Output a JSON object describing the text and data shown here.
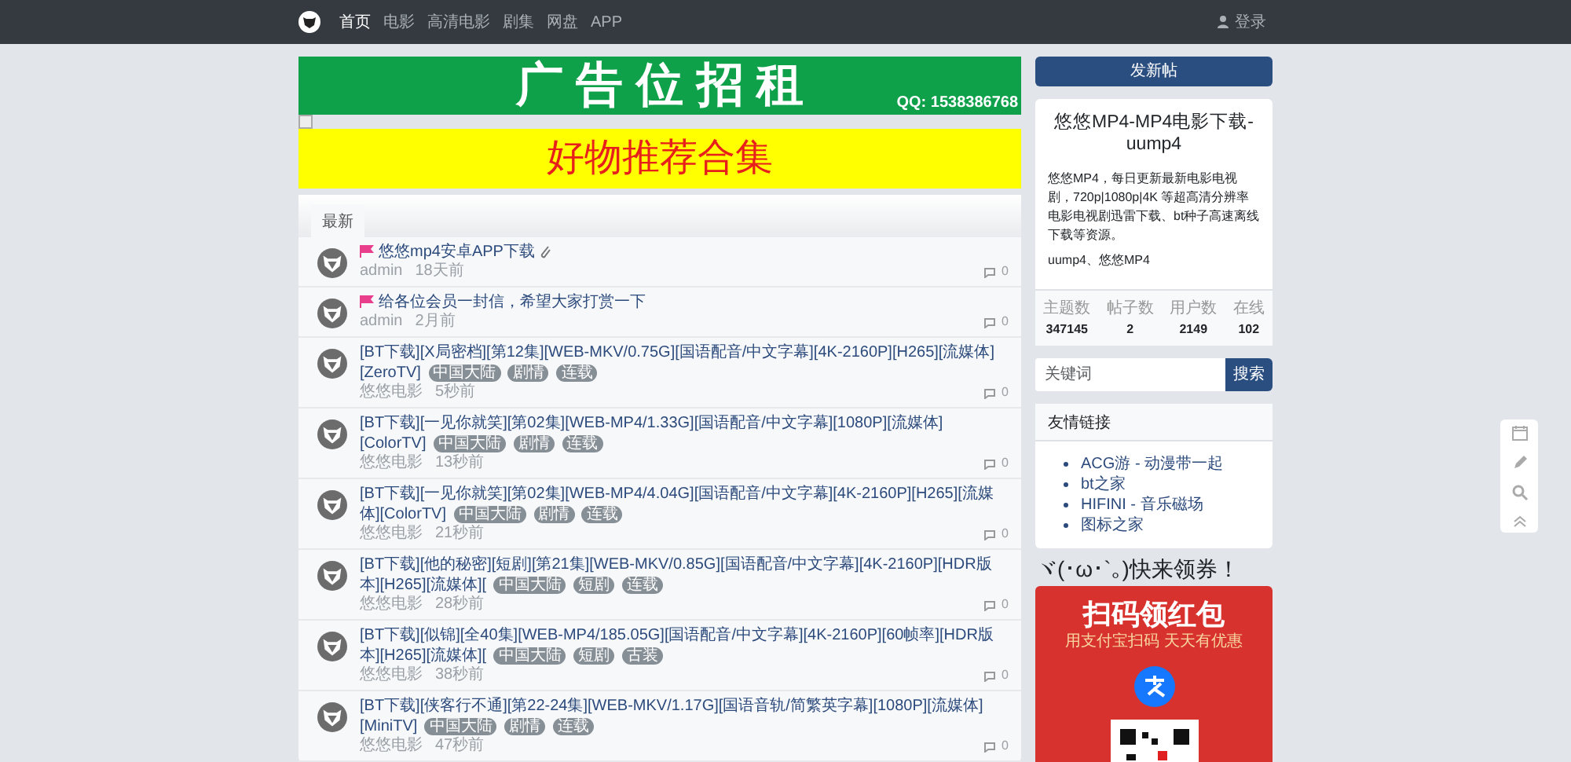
{
  "navbar": {
    "items": [
      {
        "label": "首页",
        "selected": true
      },
      {
        "label": "电影",
        "selected": false
      },
      {
        "label": "高清电影",
        "selected": false
      },
      {
        "label": "剧集",
        "selected": false
      },
      {
        "label": "网盘",
        "selected": false
      },
      {
        "label": "APP",
        "selected": false
      }
    ],
    "login": "登录"
  },
  "banners": [
    {
      "kind": "rent",
      "title": "广 告 位 招 租",
      "contact": "QQ: 1538386768"
    },
    {
      "kind": "broken"
    },
    {
      "kind": "promo",
      "title": "好物推荐合集"
    }
  ],
  "tabs": [
    {
      "label": "最新",
      "selected": true
    }
  ],
  "threads": [
    {
      "title": "悠悠mp4安卓APP下载",
      "pinned": true,
      "attachment": true,
      "author": "admin",
      "time": "18天前",
      "replies": "0"
    },
    {
      "title": "给各位会员一封信，希望大家打赏一下",
      "pinned": true,
      "attachment": false,
      "author": "admin",
      "time": "2月前",
      "replies": "0"
    },
    {
      "title": "[BT下载][X局密档][第12集][WEB-MKV/0.75G][国语配音/中文字幕][4K-2160P][H265][流媒体][ZeroTV]",
      "pinned": false,
      "attachment": false,
      "tags": [
        "中国大陆",
        "剧情",
        "连载"
      ],
      "author": "悠悠电影",
      "time": "5秒前",
      "replies": "0"
    },
    {
      "title": "[BT下载][一见你就笑][第02集][WEB-MP4/1.33G][国语配音/中文字幕][1080P][流媒体][ColorTV]",
      "pinned": false,
      "attachment": false,
      "tags": [
        "中国大陆",
        "剧情",
        "连载"
      ],
      "author": "悠悠电影",
      "time": "13秒前",
      "replies": "0"
    },
    {
      "title": "[BT下载][一见你就笑][第02集][WEB-MP4/4.04G][国语配音/中文字幕][4K-2160P][H265][流媒体][ColorTV]",
      "pinned": false,
      "attachment": false,
      "tags": [
        "中国大陆",
        "剧情",
        "连载"
      ],
      "author": "悠悠电影",
      "time": "21秒前",
      "replies": "0"
    },
    {
      "title": "[BT下载][他的秘密][短剧][第21集][WEB-MKV/0.85G][国语配音/中文字幕][4K-2160P][HDR版本][H265][流媒体][",
      "pinned": false,
      "attachment": false,
      "tags": [
        "中国大陆",
        "短剧",
        "连载"
      ],
      "author": "悠悠电影",
      "time": "28秒前",
      "replies": "0"
    },
    {
      "title": "[BT下载][似锦][全40集][WEB-MP4/185.05G][国语配音/中文字幕][4K-2160P][60帧率][HDR版本][H265][流媒体][",
      "pinned": false,
      "attachment": false,
      "tags": [
        "中国大陆",
        "短剧",
        "古装"
      ],
      "author": "悠悠电影",
      "time": "38秒前",
      "replies": "0"
    },
    {
      "title": "[BT下载][侠客行不通][第22-24集][WEB-MKV/1.17G][国语音轨/简繁英字幕][1080P][流媒体][MiniTV]",
      "pinned": false,
      "attachment": false,
      "tags": [
        "中国大陆",
        "剧情",
        "连载"
      ],
      "author": "悠悠电影",
      "time": "47秒前",
      "replies": "0"
    }
  ],
  "sidebar": {
    "post_button": "发新帖",
    "site": {
      "title": "悠悠MP4-MP4电影下载-uump4",
      "description": "悠悠MP4，每日更新最新电影电视剧，720p|1080p|4K 等超高清分辨率电影电视剧迅雷下载、bt种子高速离线下载等资源。",
      "keywords": "uump4、悠悠MP4",
      "stats": [
        {
          "label": "主题数",
          "value": "347145"
        },
        {
          "label": "帖子数",
          "value": "2"
        },
        {
          "label": "用户数",
          "value": "2149"
        },
        {
          "label": "在线",
          "value": "102"
        }
      ]
    },
    "search": {
      "placeholder": "关键词",
      "button": "搜索"
    },
    "links": {
      "title": "友情链接",
      "items": [
        "ACG游 - 动漫带一起",
        "bt之家",
        "HIFINI - 音乐磁场",
        "图标之家"
      ]
    },
    "coupon": {
      "heading": "ヾ(･ω･`｡)快来领券！",
      "title": "扫码领红包",
      "subtitle": "用支付宝扫码  天天有优惠"
    }
  }
}
